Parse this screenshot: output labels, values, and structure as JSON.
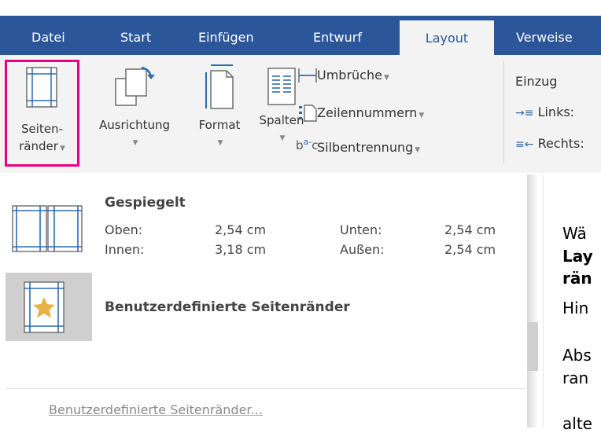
{
  "tabs": [
    "Datei",
    "Start",
    "Einfügen",
    "Entwurf",
    "Layout",
    "Verweise"
  ],
  "ribbon": {
    "margins": {
      "line1": "Seiten-",
      "line2": "ränder"
    },
    "orientation": "Ausrichtung",
    "size": "Format",
    "columns": "Spalten",
    "breaks": "Umbrüche",
    "line_numbers": "Zeilennummern",
    "hyphenation": "Silbentrennung",
    "indent_title": "Einzug",
    "indent_left": "Links:",
    "indent_right": "Rechts:"
  },
  "menu": {
    "preset": {
      "name": "Gespiegelt",
      "top_label": "Oben:",
      "top_value": "2,54 cm",
      "bottom_label": "Unten:",
      "bottom_value": "2,54 cm",
      "inner_label": "Innen:",
      "inner_value": "3,18 cm",
      "outer_label": "Außen:",
      "outer_value": "2,54 cm"
    },
    "custom_title": "Benutzerdefinierte Seitenränder",
    "custom_link": "Benutzerdefinierte Seitenränder..."
  },
  "doc_text": {
    "l1": "Wä",
    "l2": "Lay",
    "l3": "rän",
    "l4": "Hin",
    "l5": "Abs",
    "l6": "ran",
    "l7": "alte"
  },
  "colors": {
    "tabbar": "#2b579a",
    "highlight": "#e40080",
    "star": "#e8b24a"
  }
}
